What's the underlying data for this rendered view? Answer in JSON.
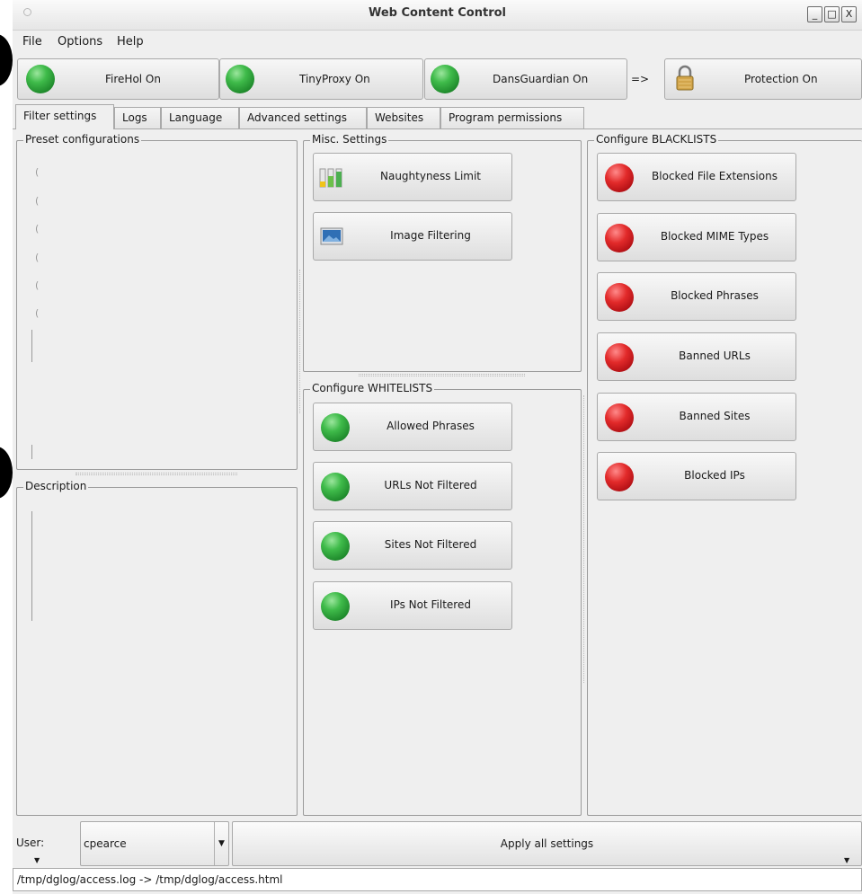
{
  "window": {
    "title": "Web Content Control",
    "wm_buttons": [
      "_",
      "□",
      "X"
    ]
  },
  "menu": [
    "File",
    "Options",
    "Help"
  ],
  "toolbar": {
    "firehol": "FireHol On",
    "tinyproxy": "TinyProxy On",
    "dansguardian": "DansGuardian On",
    "arrow": "=>",
    "protection": "Protection On"
  },
  "tabs": [
    "Filter settings",
    "Logs",
    "Language",
    "Advanced settings",
    "Websites",
    "Program permissions"
  ],
  "active_tab": "Filter settings",
  "groups": {
    "preset": "Preset configurations",
    "description": "Description",
    "misc": "Misc. Settings",
    "whitelists": "Configure WHITELISTS",
    "blacklists": "Configure BLACKLISTS"
  },
  "misc_buttons": [
    "Naughtyness Limit",
    "Image Filtering"
  ],
  "whitelist_buttons": [
    "Allowed Phrases",
    "URLs Not Filtered",
    "Sites Not Filtered",
    "IPs Not Filtered"
  ],
  "blacklist_buttons": [
    "Blocked File Extensions",
    "Blocked MIME Types",
    "Blocked Phrases",
    "Banned URLs",
    "Banned Sites",
    "Blocked IPs"
  ],
  "bottom": {
    "user_label": "User:",
    "user_value": "cpearce",
    "apply": "Apply all settings"
  },
  "status": "/tmp/dglog/access.log -> /tmp/dglog/access.html",
  "colors": {
    "led_on": "#3fbb4a",
    "led_off": "#e22a2a",
    "window_bg": "#efefef"
  }
}
